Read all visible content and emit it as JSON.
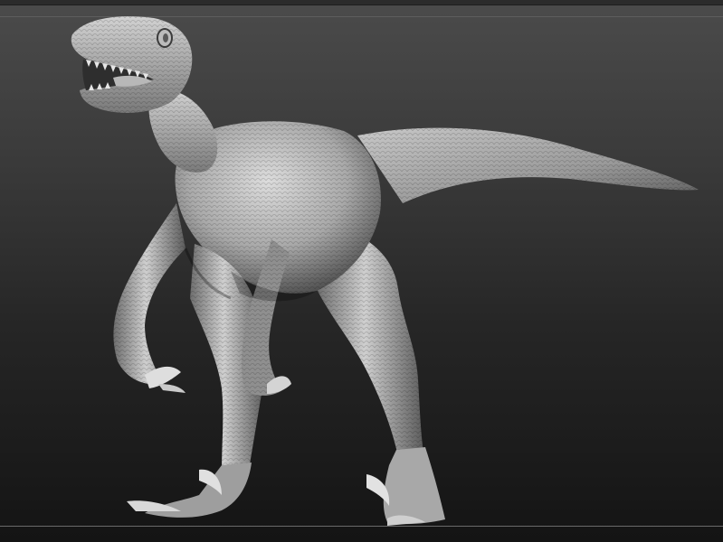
{
  "viewport": {
    "background_top": "#4b4b4b",
    "background_bottom": "#141414",
    "frame_line_color": "#6a6a6a"
  },
  "model": {
    "subject": "raptor-sculpt",
    "material_light": "#d9d9d9",
    "material_mid": "#8a8a8a",
    "material_dark": "#3a3a3a"
  }
}
